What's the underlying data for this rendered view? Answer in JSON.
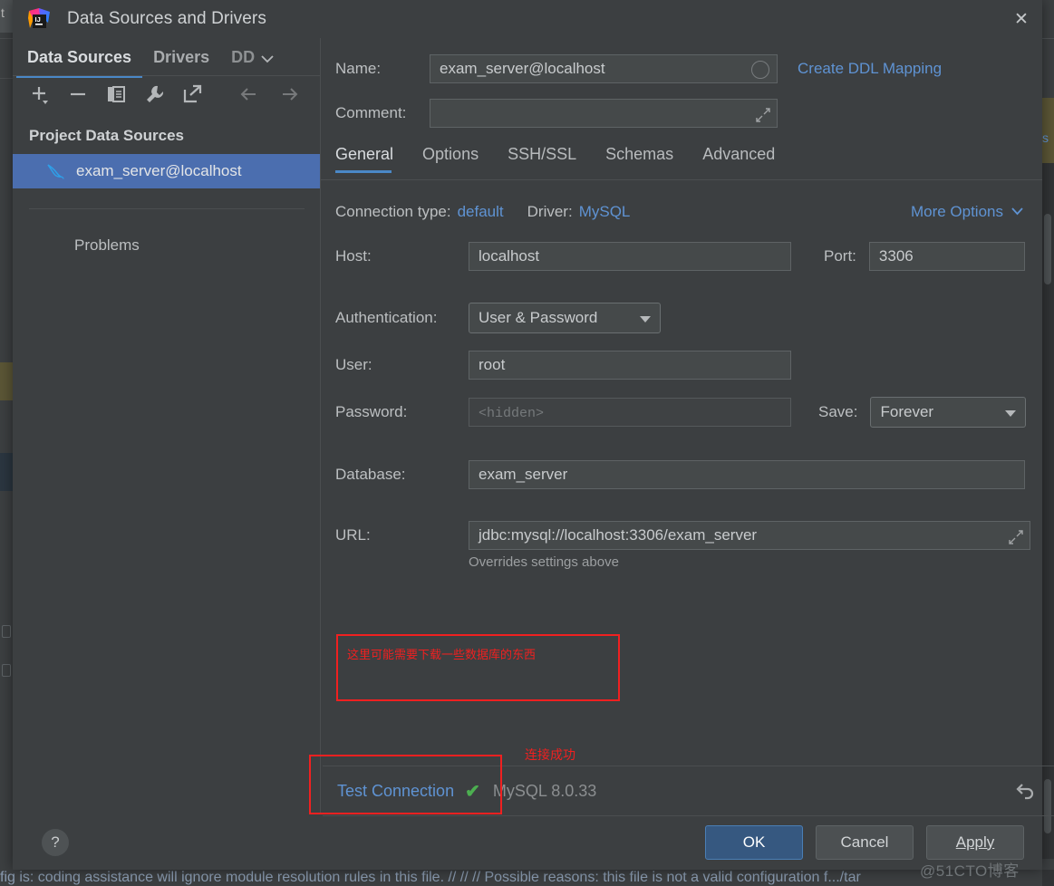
{
  "window": {
    "title": "Data Sources and Drivers",
    "app_icon": "intellij-idea-logo",
    "close_label": "✕"
  },
  "background": {
    "left_tab_text": "t",
    "right_marker_text": "s",
    "editor_line": "fig is: coding assistance will ignore module resolution rules in this file. // // // Possible reasons: this file is not a valid configuration f.../tar",
    "watermark": "@51CTO博客"
  },
  "left_panel": {
    "tabs": [
      {
        "label": "Data Sources",
        "active": true
      },
      {
        "label": "Drivers",
        "active": false
      },
      {
        "label": "DD",
        "active": false,
        "clipped": true
      }
    ],
    "tabs_overflow_icon": "chevron-down-icon",
    "toolbar": [
      {
        "name": "add-icon",
        "glyph": "+"
      },
      {
        "name": "remove-icon",
        "glyph": "−"
      },
      {
        "name": "duplicate-icon",
        "glyph": "copy"
      },
      {
        "name": "properties-wrench-icon",
        "glyph": "wrench"
      },
      {
        "name": "export-icon",
        "glyph": "arrow-out"
      },
      {
        "name": "back-arrow-icon",
        "glyph": "←"
      },
      {
        "name": "forward-arrow-icon",
        "glyph": "→"
      }
    ],
    "section_title": "Project Data Sources",
    "data_sources": [
      {
        "label": "exam_server@localhost",
        "icon": "mysql-dolphin-icon",
        "selected": true
      }
    ],
    "problems_label": "Problems"
  },
  "form": {
    "name_label": "Name:",
    "name_value": "exam_server@localhost",
    "comment_label": "Comment:",
    "comment_value": "",
    "create_ddl_mapping": "Create DDL Mapping",
    "tabs": [
      {
        "label": "General",
        "active": true
      },
      {
        "label": "Options",
        "active": false
      },
      {
        "label": "SSH/SSL",
        "active": false
      },
      {
        "label": "Schemas",
        "active": false
      },
      {
        "label": "Advanced",
        "active": false
      }
    ],
    "connection_type_label": "Connection type:",
    "connection_type_value": "default",
    "driver_label": "Driver:",
    "driver_value": "MySQL",
    "more_options": "More Options",
    "host_label": "Host:",
    "host_value": "localhost",
    "port_label": "Port:",
    "port_value": "3306",
    "auth_label": "Authentication:",
    "auth_value": "User & Password",
    "user_label": "User:",
    "user_value": "root",
    "password_label": "Password:",
    "password_placeholder": "<hidden>",
    "save_label": "Save:",
    "save_value": "Forever",
    "database_label": "Database:",
    "database_value": "exam_server",
    "url_label": "URL:",
    "url_value": "jdbc:mysql://localhost:3306/exam_server",
    "url_hint": "Overrides settings above"
  },
  "annotations": {
    "box_note": "这里可能需要下载一些数据库的东西",
    "success_note": "连接成功",
    "color": "#f02020"
  },
  "status_bar": {
    "test_connection": "Test Connection",
    "success_check": "✔",
    "db_version": "MySQL 8.0.33",
    "revert_icon": "revert-arrow-icon"
  },
  "buttons": {
    "help": "?",
    "ok": "OK",
    "cancel": "Cancel",
    "apply": "Apply",
    "apply_mnemonic": "A"
  },
  "colors": {
    "accent_blue": "#4a88c7",
    "link_blue": "#5f93d3",
    "selection_blue": "#4b6eaf",
    "primary_button": "#365880",
    "annotation_red": "#f02020",
    "success_green": "#4caf50",
    "panel_bg": "#3c3f41",
    "field_bg": "#45494a"
  }
}
